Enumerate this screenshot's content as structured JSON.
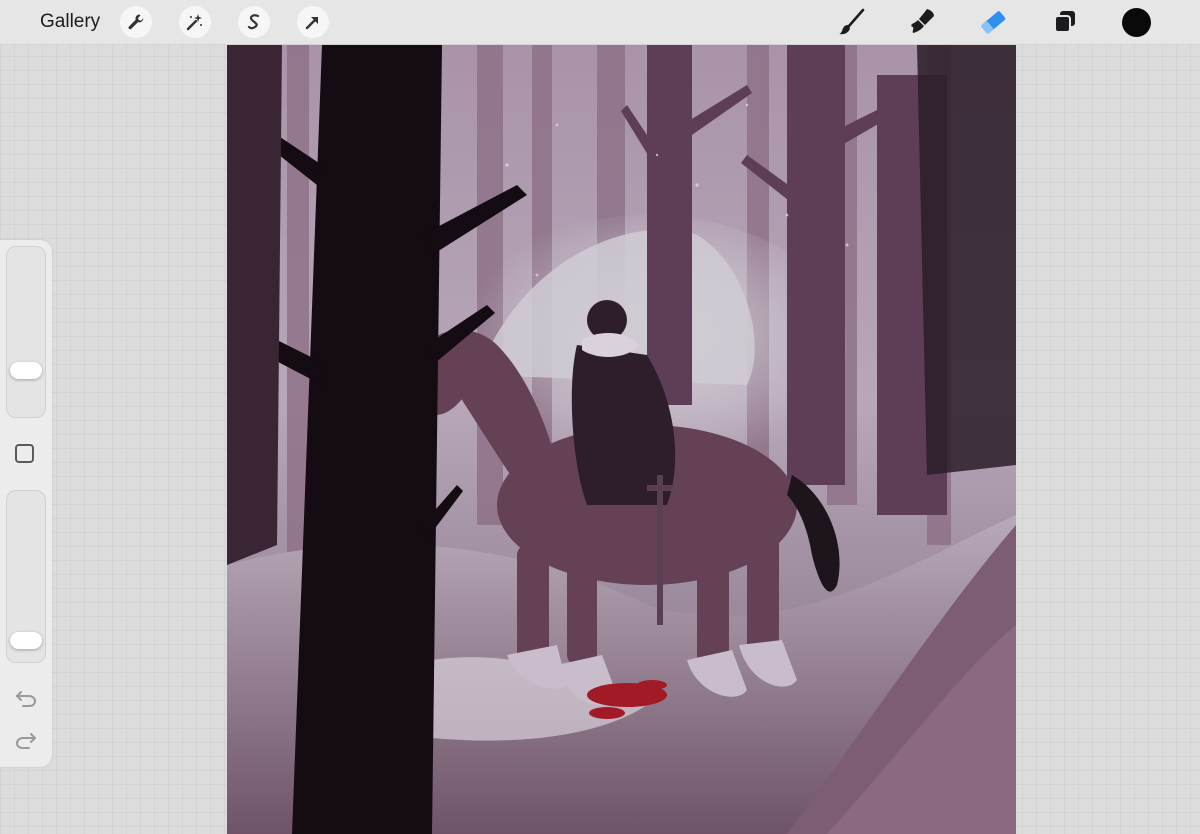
{
  "topbar": {
    "gallery_label": "Gallery",
    "actions_icon": "wrench-icon",
    "adjustments_icon": "magic-wand-icon",
    "selection_icon": "selection-s-icon",
    "transform_icon": "transform-arrow-icon",
    "tools": [
      {
        "name": "brush",
        "icon": "brush-icon",
        "active": false
      },
      {
        "name": "smudge",
        "icon": "smudge-icon",
        "active": false
      },
      {
        "name": "eraser",
        "icon": "eraser-icon",
        "active": true
      },
      {
        "name": "layers",
        "icon": "layers-icon",
        "active": false
      }
    ],
    "current_color": "#0a0a0a",
    "active_tool_color": "#2f8ff0"
  },
  "sidebar": {
    "brush_size_level": 0.24,
    "opacity_level": 0.07,
    "modify_icon": "square-modify-icon",
    "undo_icon": "undo-arrow-icon",
    "redo_icon": "redo-arrow-icon"
  },
  "canvas": {
    "artwork": "painting-rider-on-horse-in-snowy-forest",
    "palette": {
      "sky": "#b8a7b8",
      "trees": "#4a2f42",
      "snow": "#cfc3d3",
      "blood": "#a21a25"
    }
  }
}
